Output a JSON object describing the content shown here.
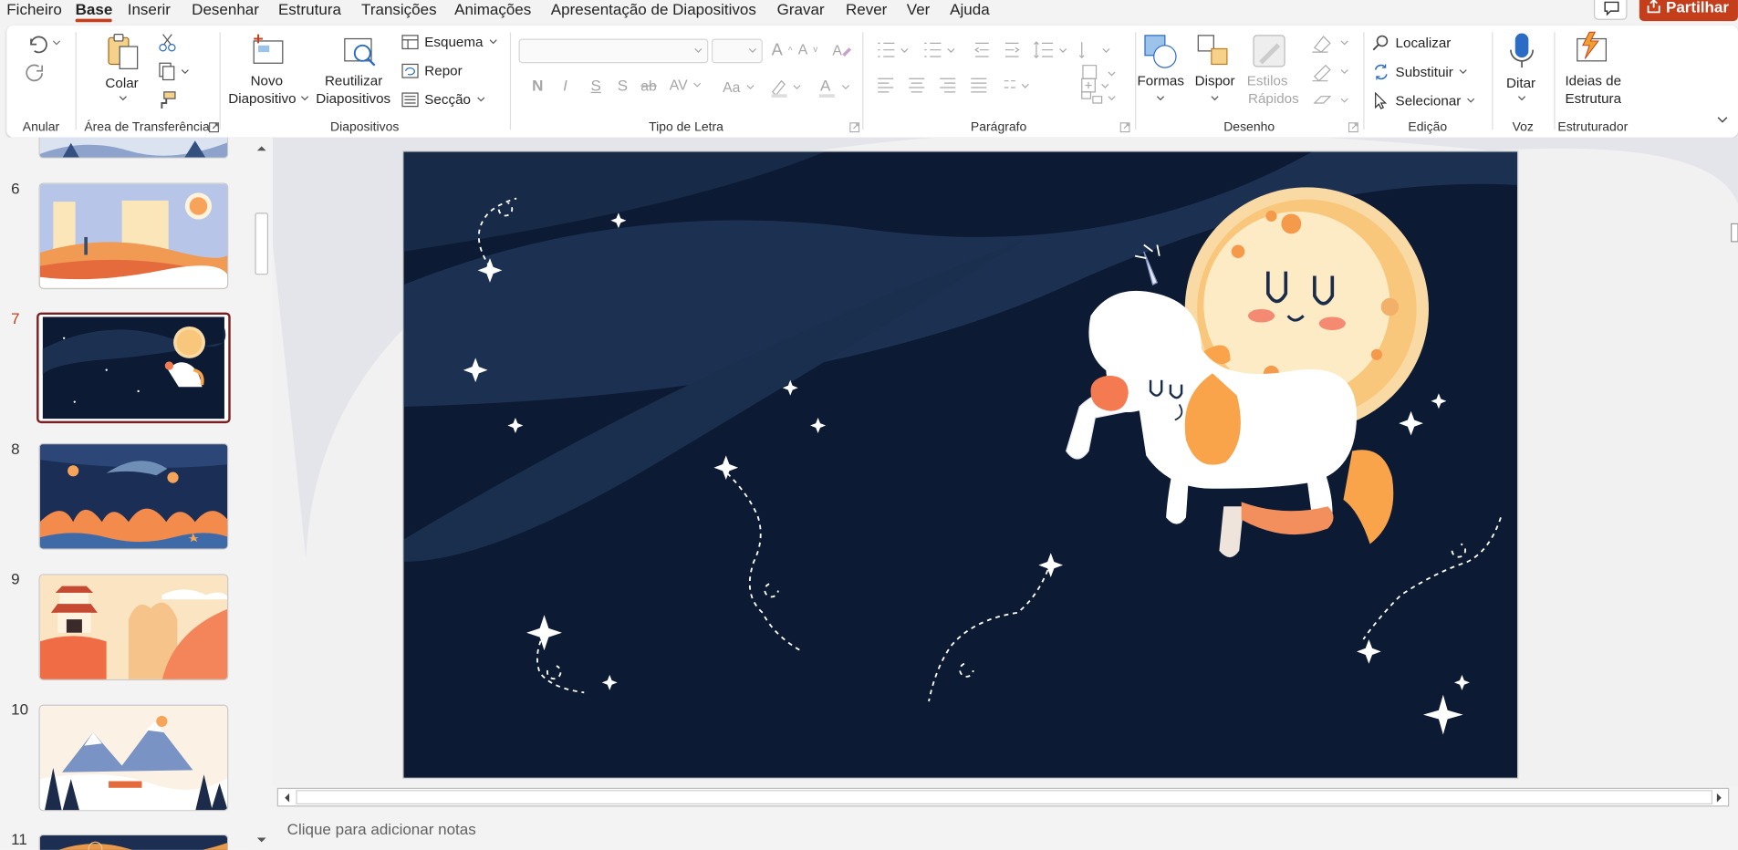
{
  "menu": {
    "items": [
      "Ficheiro",
      "Base",
      "Inserir",
      "Desenhar",
      "Estrutura",
      "Transições",
      "Animações",
      "Apresentação de Diapositivos",
      "Gravar",
      "Rever",
      "Ver",
      "Ajuda"
    ],
    "active": "Base",
    "share_label": "Partilhar"
  },
  "ribbon": {
    "undo_group": "Anular",
    "clipboard": {
      "label": "Área de Transferência",
      "paste": "Colar"
    },
    "slides": {
      "label": "Diapositivos",
      "new_slide": [
        "Novo",
        "Diapositivo"
      ],
      "reuse": [
        "Reutilizar",
        "Diapositivos"
      ],
      "layout": "Esquema",
      "reset": "Repor",
      "section": "Secção"
    },
    "font": {
      "label": "Tipo de Letra",
      "bold": "N",
      "italic": "I",
      "underline": "S",
      "shadow": "S",
      "strike": "ab",
      "spacing": "AV",
      "case": "Aa"
    },
    "paragraph": {
      "label": "Parágrafo"
    },
    "drawing": {
      "label": "Desenho",
      "shapes": "Formas",
      "arrange": "Dispor",
      "quick_styles": [
        "Estilos",
        "Rápidos"
      ]
    },
    "editing": {
      "label": "Edição",
      "find": "Localizar",
      "replace": "Substituir",
      "select": "Selecionar"
    },
    "voice": {
      "label": "Voz",
      "dictate": "Ditar"
    },
    "designer": {
      "label": "Estruturador",
      "ideas": [
        "Ideias de",
        "Estrutura"
      ]
    }
  },
  "slides": [
    {
      "num": "6",
      "theme": "desert"
    },
    {
      "num": "7",
      "theme": "space",
      "selected": true
    },
    {
      "num": "8",
      "theme": "ocean"
    },
    {
      "num": "9",
      "theme": "temple"
    },
    {
      "num": "10",
      "theme": "winter"
    },
    {
      "num": "11",
      "theme": "night"
    }
  ],
  "notes_placeholder": "Clique para adicionar notas",
  "colors": {
    "accent": "#c43e1c",
    "slide_bg": "#0c1b33",
    "moon": "#f9c77c",
    "moon_ring": "#f9d9a4"
  }
}
